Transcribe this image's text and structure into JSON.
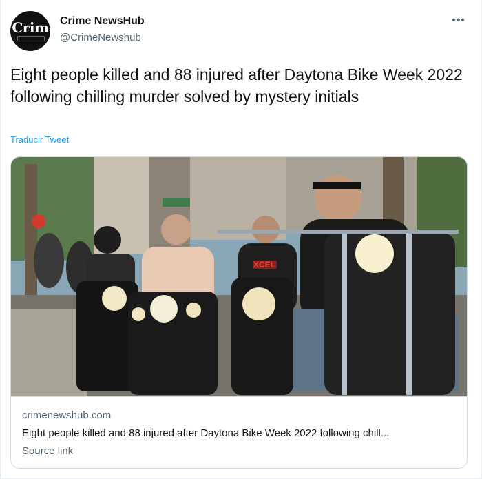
{
  "author": {
    "avatar_text": "Crim",
    "name": "Crime NewsHub",
    "handle": "@CrimeNewshub"
  },
  "more_icon": "•••",
  "tweet": {
    "text": "Eight people killed and 88 injured after Daytona Bike Week 2022 following chilling murder solved by mystery initials",
    "translate_label": "Traducir Tweet"
  },
  "card": {
    "domain": "crimenewshub.com",
    "title": "Eight people killed and 88 injured after Daytona Bike Week 2022 following chill...",
    "source_label": "Source link",
    "image_sign_text": "XCEL"
  },
  "colors": {
    "link": "#1d9bf0",
    "secondary_text": "#536471",
    "border": "#cfd9de"
  }
}
